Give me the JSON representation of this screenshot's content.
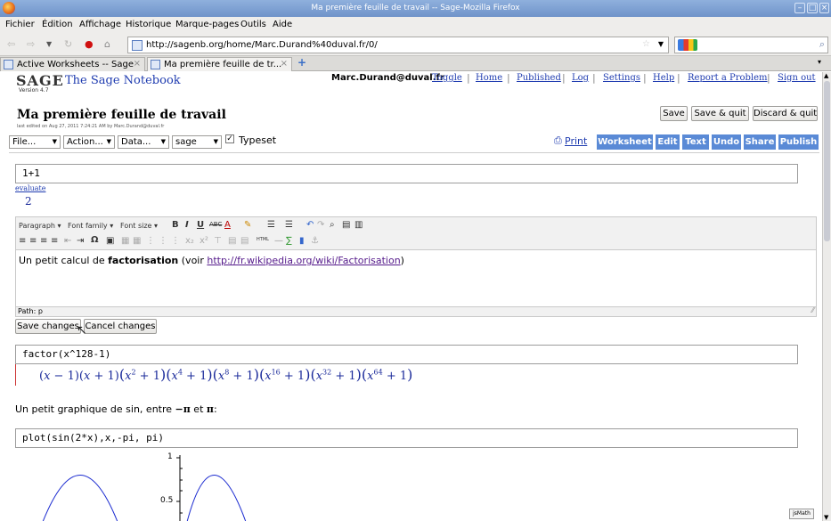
{
  "window": {
    "title": "Ma première feuille de travail -- Sage-Mozilla Firefox"
  },
  "menu": [
    "Fichier",
    "Édition",
    "Affichage",
    "Historique",
    "Marque-pages",
    "Outils",
    "Aide"
  ],
  "navigation": {
    "url": "http://sagenb.org/home/Marc.Durand%40duval.fr/0/"
  },
  "tabs": [
    {
      "label": "Active Worksheets -- Sage"
    },
    {
      "label": "Ma première feuille de tr..."
    }
  ],
  "header": {
    "logo_text": "SAGE",
    "notebook_title": "The Sage Notebook",
    "version": "Version 4.7",
    "user": "Marc.Durand@duval.fr",
    "links": [
      "Toggle",
      "Home",
      "Published",
      "Log",
      "Settings",
      "Help",
      "Report a Problem",
      "Sign out"
    ]
  },
  "worksheet": {
    "title": "Ma première feuille de travail",
    "last_edited": "last edited on Aug 27, 2011 7:24:21 AM by Marc.Durand@duval.fr",
    "buttons": {
      "save": "Save",
      "save_quit": "Save & quit",
      "discard_quit": "Discard & quit"
    },
    "dropdowns": {
      "file": "File...",
      "action": "Action...",
      "data": "Data...",
      "system": "sage"
    },
    "typeset_label": "Typeset",
    "typeset_checked": true,
    "print_label": "Print",
    "tab_buttons": [
      "Worksheet",
      "Edit",
      "Text",
      "Undo",
      "Share",
      "Publish"
    ]
  },
  "cells": {
    "cell1": {
      "input": "1+1",
      "evaluate": "evaluate",
      "output": "2"
    },
    "editor": {
      "paragraph": "Paragraph",
      "font_family": "Font family",
      "font_size": "Font size",
      "text_before": "Un petit calcul de ",
      "text_bold": "factorisation",
      "text_mid": " (voir ",
      "text_link": "http://fr.wikipedia.org/wiki/Factorisation",
      "text_after": ")",
      "path": "Path: p",
      "save_changes": "Save changes",
      "cancel_changes": "Cancel changes"
    },
    "cell2": {
      "input": "factor(x^128-1)"
    },
    "text2": {
      "before": "Un petit graphique de sin, entre ",
      "neg_pi": "−π",
      "and": " et ",
      "pi": "π",
      "after": ":"
    },
    "cell3": {
      "input": "plot(sin(2*x),x,-pi, pi)"
    }
  },
  "plot": {
    "y_ticks": [
      "1",
      "0.5"
    ]
  },
  "jsmath_label": "jsMath",
  "colors": {
    "accent": "#5a8ad6",
    "link": "#1f3cb0",
    "math": "#1a2a9a"
  }
}
